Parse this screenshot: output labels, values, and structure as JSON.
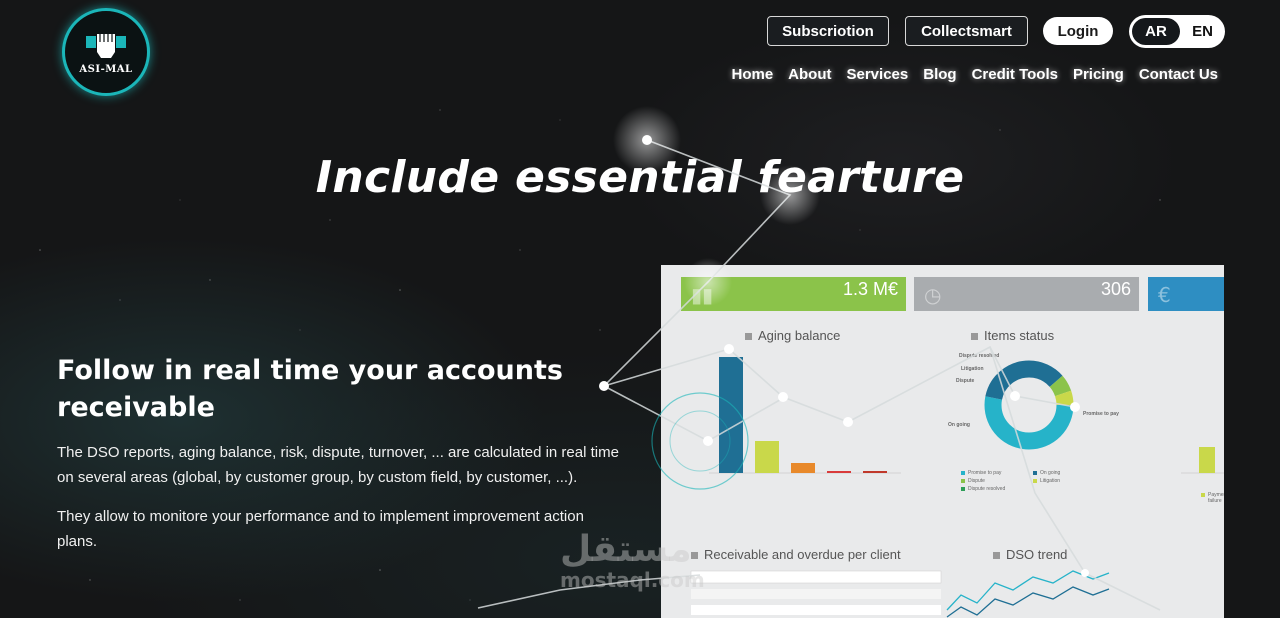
{
  "brand": {
    "logo_text": "ASI-MAL"
  },
  "header": {
    "subscription_label": "Subscriotion",
    "collectsmart_label": "Collectsmart",
    "login_label": "Login",
    "lang_ar": "AR",
    "lang_en": "EN"
  },
  "nav": {
    "items": [
      "Home",
      "About",
      "Services",
      "Blog",
      "Credit Tools",
      "Pricing",
      "Contact Us"
    ]
  },
  "hero": {
    "title": "Include essential fearture"
  },
  "feature": {
    "title": "Follow in real time your accounts receivable",
    "paragraph_1": "The DSO reports, aging balance, risk, dispute, turnover, ... are calculated in real time on several areas (global, by customer group, by custom field, by customer, ...).",
    "paragraph_2": "They allow to monitore your performance and to implement improvement action plans."
  },
  "dashboard": {
    "kpi_1_value": "1.3 M€",
    "kpi_2_value": "306",
    "kpi_3_icon": "€",
    "aging_title": "Aging balance",
    "items_title": "Items status",
    "receivable_title": "Receivable and overdue per client",
    "dso_title": "DSO trend",
    "legend": {
      "promise": "Promise to pay",
      "ongoing": "On going",
      "dispute": "Dispute",
      "litigation": "Litigation",
      "dispute_resolved": "Dispute resolved",
      "payment": "Payment failure"
    },
    "donut_labels": {
      "dispute_resolved": "Dispute resolved",
      "litigation": "Litigation",
      "dispute": "Dispute",
      "ongoing": "On going",
      "promise": "Promise to pay"
    },
    "colors": {
      "teal": "#26b3c9",
      "navy": "#1f6f94",
      "yellow_green": "#c9d84a",
      "green": "#8bc34a",
      "orange": "#e8892a",
      "red": "#d93b3b",
      "kpi_green": "#8bc34a"
    }
  },
  "watermark": {
    "arabic": "مستقل",
    "latin": "mostaql.com"
  },
  "icons": {
    "logo": "fist-icon",
    "kpi_1": "chart-icon",
    "kpi_2": "clock-icon",
    "kpi_3": "euro-icon"
  }
}
